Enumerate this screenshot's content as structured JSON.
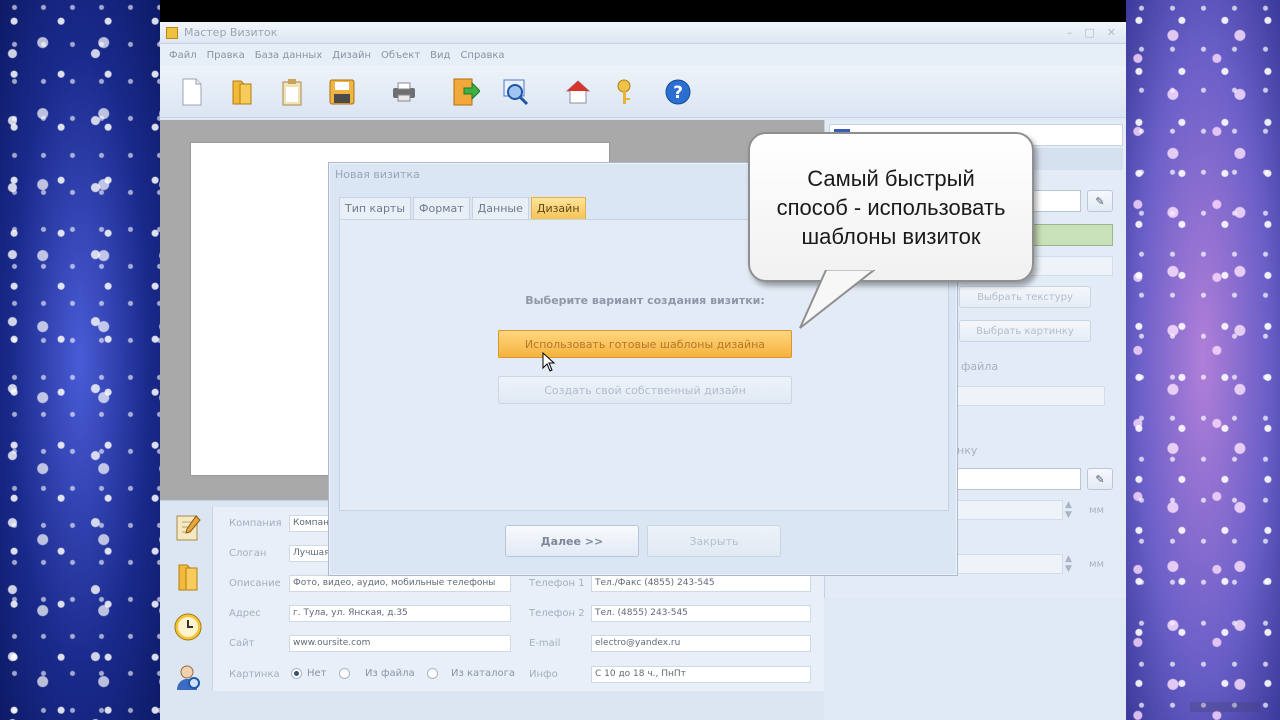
{
  "window": {
    "title": "Мастер Визиток"
  },
  "menu": [
    "Файл",
    "Правка",
    "База данных",
    "Дизайн",
    "Объект",
    "Вид",
    "Справка"
  ],
  "toolbar": {
    "icons": [
      "new-document-icon",
      "open-folder-icon",
      "clipboard-icon",
      "save-icon",
      "print-icon",
      "export-icon",
      "preview-icon",
      "home-icon",
      "keys-icon",
      "help-icon"
    ]
  },
  "dialog": {
    "title": "Новая визитка",
    "tabs": [
      "Тип карты",
      "Формат",
      "Данные",
      "Дизайн"
    ],
    "active_tab": "Дизайн",
    "prompt": "Выберите вариант создания визитки:",
    "option_templates": "Использовать готовые шаблоны дизайна",
    "option_custom": "Создать свой собственный дизайн",
    "next_button": "Далее >>",
    "close_button": "Закрыть"
  },
  "callout": {
    "lines": [
      "Самый быстрый",
      "способ - использовать",
      "шаблоны визиток"
    ]
  },
  "right_panel": {
    "choose_texture": "Выбрать текстуру",
    "choose_picture": "Выбрать картинку",
    "file_label": "файла",
    "frame_label": "нку",
    "unit_mm": "мм"
  },
  "form": {
    "company_label": "Компания",
    "company_value": "Компан",
    "slogan_label": "Слоган",
    "slogan_value": "Лучшая",
    "description_label": "Описание",
    "description_value": "Фото, видео, аудио, мобильные телефоны",
    "address_label": "Адрес",
    "address_value": "г. Тула, ул. Янская, д.35",
    "site_label": "Сайт",
    "site_value": "www.oursite.com",
    "picture_label": "Картинка",
    "radio_none": "Нет",
    "radio_file": "Из файла",
    "radio_catalog": "Из каталога",
    "phone1_label": "Телефон 1",
    "phone1_value": "Тел./Факс (4855) 243-545",
    "phone2_label": "Телефон 2",
    "phone2_value": "Тел. (4855) 243-545",
    "email_label": "E-mail",
    "email_value": "electro@yandex.ru",
    "info_label": "Инфо",
    "info_value": "С 10 до 18 ч., ПнПт"
  }
}
